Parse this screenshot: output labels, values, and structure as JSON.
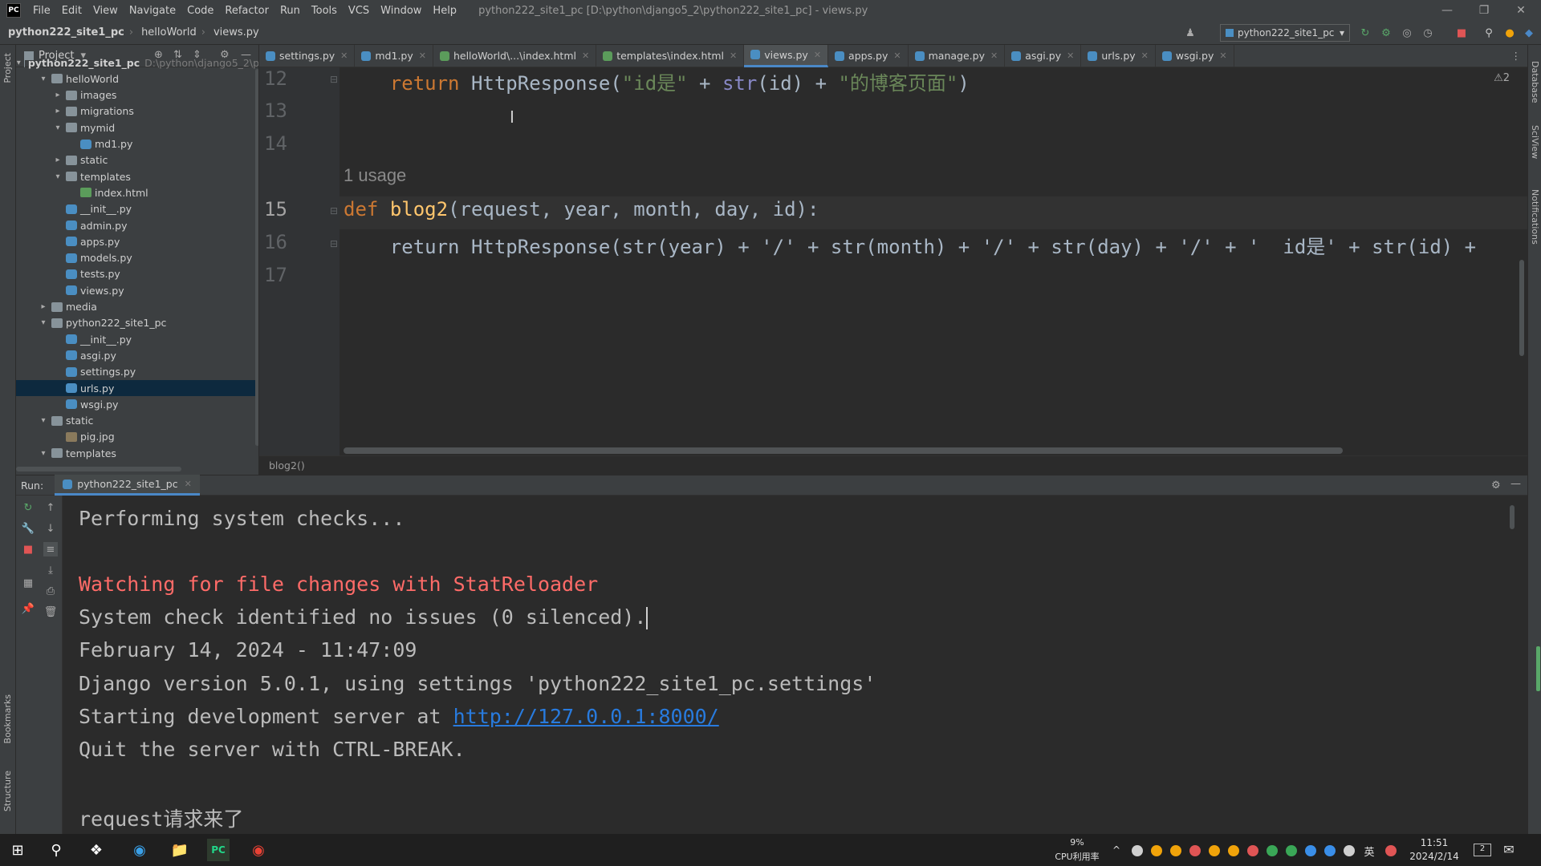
{
  "menubar": {
    "logo": "PC",
    "items": [
      "File",
      "Edit",
      "View",
      "Navigate",
      "Code",
      "Refactor",
      "Run",
      "Tools",
      "VCS",
      "Window",
      "Help"
    ],
    "title": "python222_site1_pc [D:\\python\\django5_2\\python222_site1_pc] - views.py"
  },
  "navbar": {
    "crumbs": [
      "python222_site1_pc",
      "helloWorld",
      "views.py"
    ],
    "run_config": "python222_site1_pc"
  },
  "sidebar": {
    "left_labels": [
      "Project",
      "Bookmarks",
      "Structure"
    ],
    "right_labels": [
      "Database",
      "SciView",
      "Notifications"
    ]
  },
  "project": {
    "header": "Project",
    "tree": [
      {
        "label": "python222_site1_pc",
        "path": "D:\\python\\django5_2\\p",
        "depth": 0,
        "type": "folder",
        "open": true
      },
      {
        "label": "helloWorld",
        "depth": 1,
        "type": "folder",
        "open": true
      },
      {
        "label": "images",
        "depth": 2,
        "type": "folder",
        "open": false
      },
      {
        "label": "migrations",
        "depth": 2,
        "type": "folder",
        "open": false
      },
      {
        "label": "mymid",
        "depth": 2,
        "type": "folder",
        "open": true
      },
      {
        "label": "md1.py",
        "depth": 3,
        "type": "py"
      },
      {
        "label": "static",
        "depth": 2,
        "type": "folder",
        "open": false
      },
      {
        "label": "templates",
        "depth": 2,
        "type": "folder",
        "open": true
      },
      {
        "label": "index.html",
        "depth": 3,
        "type": "html"
      },
      {
        "label": "__init__.py",
        "depth": 2,
        "type": "py"
      },
      {
        "label": "admin.py",
        "depth": 2,
        "type": "py"
      },
      {
        "label": "apps.py",
        "depth": 2,
        "type": "py"
      },
      {
        "label": "models.py",
        "depth": 2,
        "type": "py"
      },
      {
        "label": "tests.py",
        "depth": 2,
        "type": "py"
      },
      {
        "label": "views.py",
        "depth": 2,
        "type": "py"
      },
      {
        "label": "media",
        "depth": 1,
        "type": "folder",
        "open": false
      },
      {
        "label": "python222_site1_pc",
        "depth": 1,
        "type": "folder",
        "open": true
      },
      {
        "label": "__init__.py",
        "depth": 2,
        "type": "py"
      },
      {
        "label": "asgi.py",
        "depth": 2,
        "type": "py"
      },
      {
        "label": "settings.py",
        "depth": 2,
        "type": "py"
      },
      {
        "label": "urls.py",
        "depth": 2,
        "type": "py",
        "selected": true
      },
      {
        "label": "wsgi.py",
        "depth": 2,
        "type": "py"
      },
      {
        "label": "static",
        "depth": 1,
        "type": "folder",
        "open": true
      },
      {
        "label": "pig.jpg",
        "depth": 2,
        "type": "jpg"
      },
      {
        "label": "templates",
        "depth": 1,
        "type": "folder",
        "open": true
      }
    ]
  },
  "tabs": [
    {
      "label": "settings.py",
      "type": "py"
    },
    {
      "label": "md1.py",
      "type": "py"
    },
    {
      "label": "helloWorld\\...\\index.html",
      "type": "html"
    },
    {
      "label": "templates\\index.html",
      "type": "html"
    },
    {
      "label": "views.py",
      "type": "py",
      "active": true
    },
    {
      "label": "apps.py",
      "type": "py"
    },
    {
      "label": "manage.py",
      "type": "py"
    },
    {
      "label": "asgi.py",
      "type": "py"
    },
    {
      "label": "urls.py",
      "type": "py"
    },
    {
      "label": "wsgi.py",
      "type": "py"
    }
  ],
  "editor": {
    "warning_badge": "⚠2",
    "line_numbers": [
      "12",
      "13",
      "14",
      "15",
      "16",
      "17"
    ],
    "usage_hint": "1 usage",
    "breadcrumb": "blog2()",
    "line12": {
      "kw": "return",
      "fn": "HttpResponse",
      "s1": "\"id是\"",
      "bi": "str",
      "arg": "id",
      "s2": "\"的博客页面\""
    },
    "line15": {
      "kw": "def",
      "fn": "blog2",
      "params": "(request, year, month, day, id):"
    },
    "line16_text": "return HttpResponse(str(year) + '/' + str(month) + '/' + str(day) + '/' + '  id是' + str(id) +"
  },
  "run": {
    "label": "Run:",
    "tab": "python222_site1_pc",
    "console": {
      "line1": "Performing system checks...",
      "line2": "Watching for file changes with StatReloader",
      "line3": "System check identified no issues (0 silenced).",
      "line4": "February 14, 2024 - 11:47:09",
      "line5": "Django version 5.0.1, using settings 'python222_site1_pc.settings'",
      "line6_prefix": "Starting development server at ",
      "line6_link": "http://127.0.0.1:8000/",
      "line7": "Quit the server with CTRL-BREAK.",
      "line8": "request请求来了"
    }
  },
  "taskbar": {
    "cpu_value": "9%",
    "cpu_label": "CPU利用率",
    "time": "11:51",
    "date": "2024/2/14",
    "ime": "英",
    "notifications": "2"
  },
  "colors": {
    "accent": "#4a88c7",
    "keyword": "#cc7832",
    "string": "#6a8759",
    "function": "#ffc66d",
    "error": "#ff6b68",
    "link": "#287bde"
  }
}
